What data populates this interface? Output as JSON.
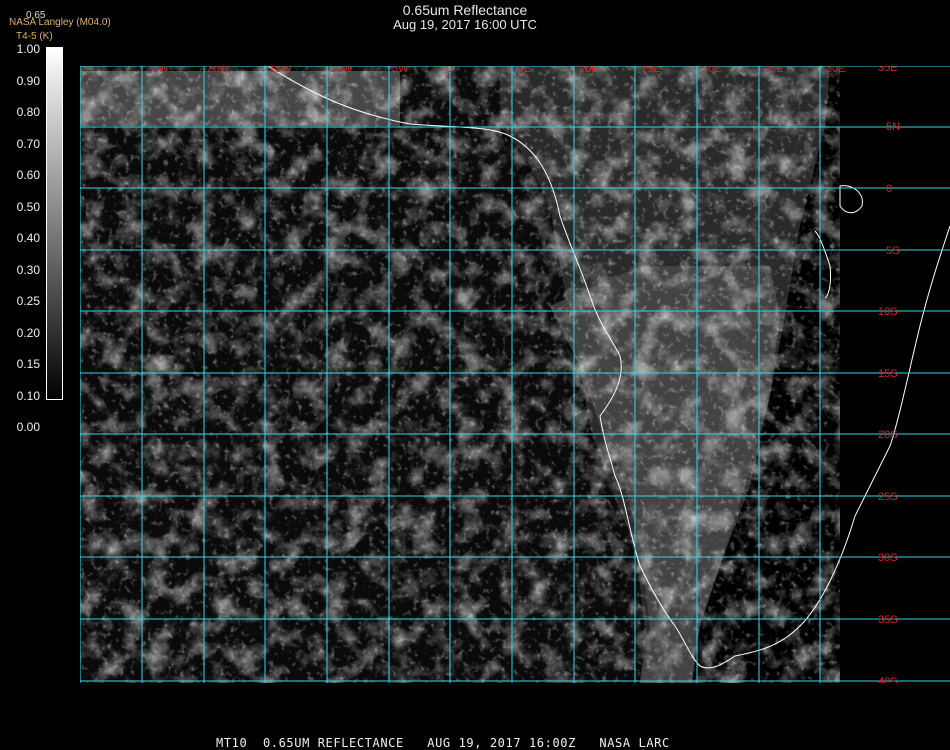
{
  "title": "0.65um Reflectance",
  "subtitle": "Aug 19, 2017 16:00 UTC",
  "credit": "NASA Langley (M04.0)",
  "credit_sub": "T4-5 (K)",
  "colorbar": {
    "top_value": "0.65",
    "ticks": [
      "1.00",
      "0.90",
      "0.80",
      "0.70",
      "0.60",
      "0.50",
      "0.40",
      "0.30",
      "0.25",
      "0.20",
      "0.15",
      "0.10",
      "0.00"
    ]
  },
  "map": {
    "lon_labels": [
      "25W",
      "20W",
      "15W",
      "10W",
      "5W",
      "0",
      "5E",
      "10E",
      "15E",
      "20E",
      "25E",
      "30E"
    ],
    "lat_labels": [
      "35E",
      "5N",
      "0",
      "5S",
      "10S",
      "15S",
      "20S",
      "25S",
      "30S",
      "35S",
      "40S"
    ],
    "colors": {
      "grid": "#33d6e6",
      "labels": "#e02020",
      "coast": "#ffffff"
    }
  },
  "footer": "MT10  0.65UM REFLECTANCE   AUG 19, 2017 16:00Z   NASA LARC"
}
